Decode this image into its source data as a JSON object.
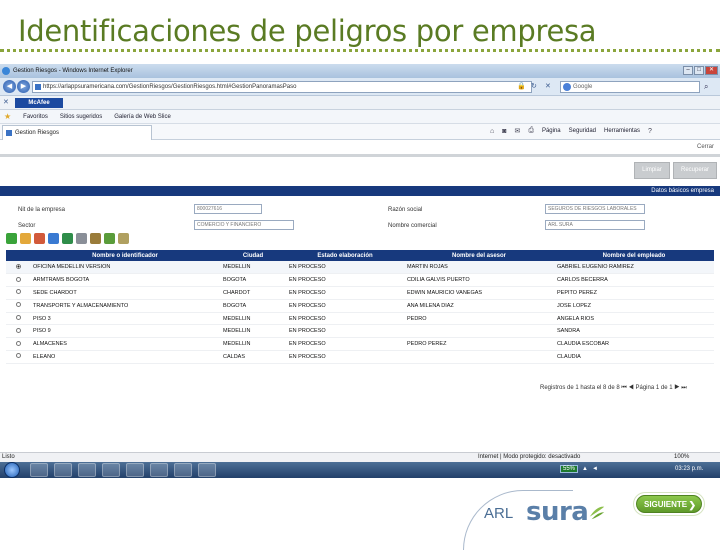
{
  "slide": {
    "title": "Identificaciones de peligros por empresa"
  },
  "browser": {
    "title": "Gestion Riesgos - Windows Internet Explorer",
    "url": "https://arlappsuramericana.com/GestionRiesgos/GestionRiesgos.html#GestionPanoramasPaso",
    "search_placeholder": "Google",
    "mcafee": "McAfee",
    "favorites": "Favoritos",
    "suggested_sites": "Sitios sugeridos",
    "web_slice": "Galería de Web Slice",
    "tab": "Gestion Riesgos",
    "cmd": {
      "page": "Página",
      "security": "Seguridad",
      "tools": "Herramientas"
    }
  },
  "app": {
    "close": "Cerrar",
    "clear": "Limpiar",
    "search_btn": "Recuperar",
    "section": "Datos básicos empresa",
    "fields": {
      "nit_label": "Nit de la empresa",
      "nit_value": "800027616",
      "razon_label": "Razón social",
      "razon_value": "SEGUROS DE RIESGOS LABORALES",
      "sector_label": "Sector",
      "sector_value": "COMERCIO Y FINANCIERO",
      "nombre_label": "Nombre comercial",
      "nombre_value": "ARL SURA"
    },
    "table": {
      "headers": [
        "Nombre o identificador",
        "Ciudad",
        "Estado elaboración",
        "Nombre del asesor",
        "Nombre del empleado"
      ],
      "rows": [
        [
          "OFICINA MEDELLIN VERSION",
          "MEDELLIN",
          "EN PROCESO",
          "MARTIN ROJAS",
          "GABRIEL EUGENIO RAMIREZ"
        ],
        [
          "ARMTRAMS BOGOTA",
          "BOGOTA",
          "EN PROCESO",
          "CDILIA GALVIS PUERTO",
          "CARLOS BECERRA"
        ],
        [
          "SEDE CHARDOT",
          "CHARDOT",
          "EN PROCESO",
          "EDWIN MAURICIO VANEGAS",
          "PEPITO PEREZ"
        ],
        [
          "TRANSPORTE Y ALMACENAMIENTO",
          "BOGOTA",
          "EN PROCESO",
          "ANA MILENA DIAZ",
          "JOSE LOPEZ"
        ],
        [
          "PISO 3",
          "MEDELLIN",
          "EN PROCESO",
          "PEDRO",
          "ANGELA RIOS"
        ],
        [
          "PISO 9",
          "MEDELLIN",
          "EN PROCESO",
          "",
          "SANDRA"
        ],
        [
          "ALMACENES",
          "MEDELLIN",
          "EN PROCESO",
          "PEDRO PEREZ",
          "CLAUDIA ESCOBAR"
        ],
        [
          "ELEANO",
          "CALDAS",
          "EN PROCESO",
          "",
          "CLAUDIA"
        ]
      ]
    },
    "pager_text": "Registros de 1 hasta el 8 de 8",
    "pager_page": "Página 1 de 1"
  },
  "statusbar": {
    "left": "Listo",
    "middle": "Internet | Modo protegido: desactivado",
    "zoom": "100%"
  },
  "taskbar": {
    "battery": "55%",
    "clock": "03:23 p.m."
  },
  "footer": {
    "arl": "ARL",
    "brand": "sura",
    "next": "SIGUIENTE"
  },
  "colors": {
    "title_green": "#5a7b23",
    "header_blue": "#17397d",
    "next_green": "#6ca535"
  }
}
